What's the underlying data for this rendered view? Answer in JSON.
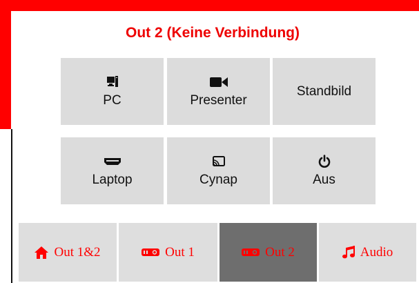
{
  "output": {
    "title": "Out 2 (Keine Verbindung)"
  },
  "sources": [
    {
      "label": "PC",
      "icon": "desktop-computer-icon"
    },
    {
      "label": "Presenter",
      "icon": "video-camera-icon"
    },
    {
      "label": "Standbild",
      "icon": ""
    },
    {
      "label": "Laptop",
      "icon": "hdmi-port-icon"
    },
    {
      "label": "Cynap",
      "icon": "cast-screen-icon"
    },
    {
      "label": "Aus",
      "icon": "power-icon"
    }
  ],
  "tabs": [
    {
      "label": "Out 1&2",
      "icon": "home-icon",
      "active": false
    },
    {
      "label": "Out 1",
      "icon": "projector-icon",
      "active": false
    },
    {
      "label": "Out 2",
      "icon": "projector-icon",
      "active": true
    },
    {
      "label": "Audio",
      "icon": "music-note-icon",
      "active": false
    }
  ],
  "colors": {
    "accent": "#ff0000",
    "button_bg": "#dcdcdc",
    "active_tab_bg": "#6e6e6e"
  }
}
